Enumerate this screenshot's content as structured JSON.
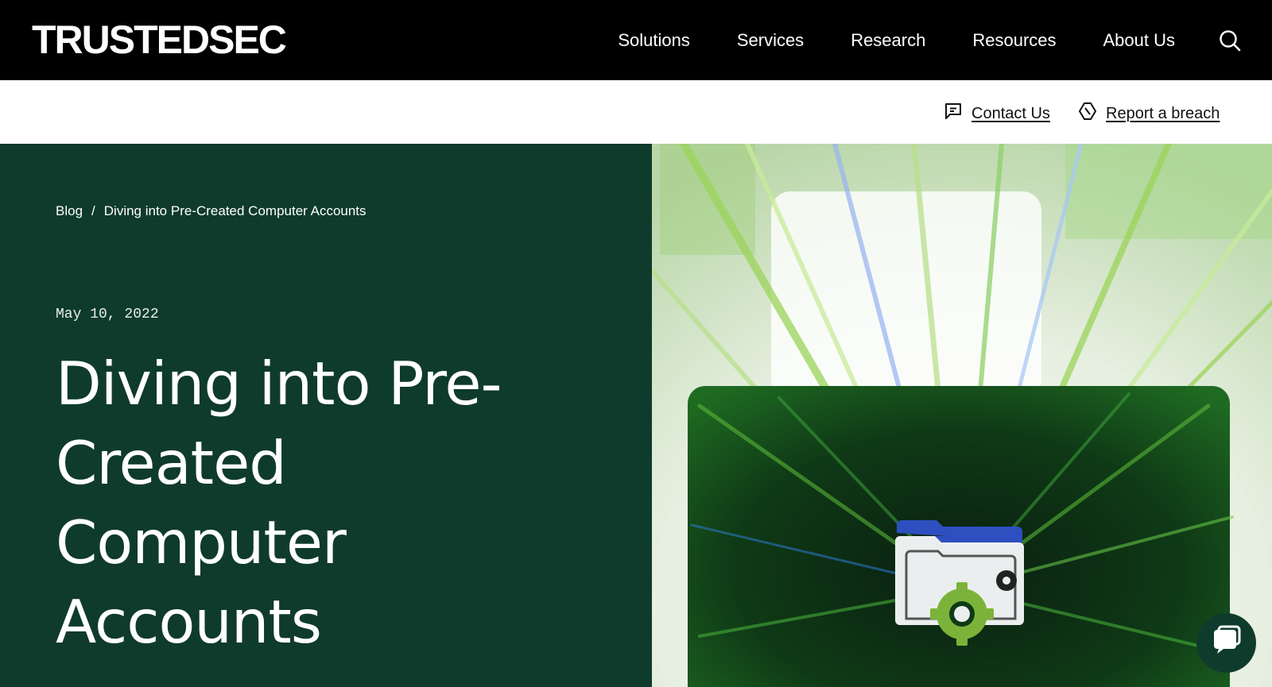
{
  "brand": {
    "logo_text": "TRUSTEDSEC"
  },
  "nav": {
    "items": [
      {
        "label": "Solutions"
      },
      {
        "label": "Services"
      },
      {
        "label": "Research"
      },
      {
        "label": "Resources"
      },
      {
        "label": "About Us"
      }
    ],
    "search_icon": "search-icon"
  },
  "utility": {
    "contact_label": "Contact Us",
    "contact_icon": "chat-square-icon",
    "breach_label": "Report a breach",
    "breach_icon": "alert-octagon-icon"
  },
  "breadcrumb": {
    "root": "Blog",
    "separator": "/",
    "current": "Diving into Pre-Created Computer Accounts"
  },
  "article": {
    "date": "May 10, 2022",
    "title": "Diving into Pre-Created Computer Accounts"
  },
  "hero_image": {
    "icon": "folder-gear-icon"
  },
  "chat_widget": {
    "icon": "chat-bubble-icon"
  },
  "colors": {
    "topbar_bg": "#000000",
    "hero_bg": "#0f3b2c",
    "accent_green": "#7bb33a",
    "accent_blue": "#2d4fbf"
  }
}
